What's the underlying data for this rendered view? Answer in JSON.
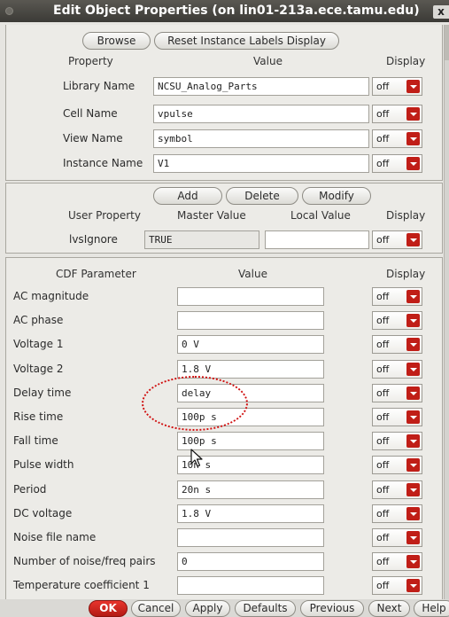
{
  "window": {
    "title": "Edit Object Properties (on lin01-213a.ece.tamu.edu)",
    "close_label": "x"
  },
  "toolbar": {
    "browse_label": "Browse",
    "reset_label": "Reset Instance Labels Display"
  },
  "instance": {
    "headers": {
      "property": "Property",
      "value": "Value",
      "display": "Display"
    },
    "rows": [
      {
        "label": "Library Name",
        "value": "NCSU_Analog_Parts",
        "display": "off"
      },
      {
        "label": "Cell Name",
        "value": "vpulse",
        "display": "off"
      },
      {
        "label": "View Name",
        "value": "symbol",
        "display": "off"
      },
      {
        "label": "Instance Name",
        "value": "V1",
        "display": "off"
      }
    ]
  },
  "user_props": {
    "add_label": "Add",
    "delete_label": "Delete",
    "modify_label": "Modify",
    "headers": {
      "property": "User Property",
      "master": "Master Value",
      "local": "Local Value",
      "display": "Display"
    },
    "rows": [
      {
        "label": "lvsIgnore",
        "master": "TRUE",
        "local": "",
        "display": "off"
      }
    ]
  },
  "cdf": {
    "headers": {
      "param": "CDF Parameter",
      "value": "Value",
      "display": "Display"
    },
    "rows": [
      {
        "label": "AC magnitude",
        "value": "",
        "display": "off"
      },
      {
        "label": "AC phase",
        "value": "",
        "display": "off"
      },
      {
        "label": "Voltage 1",
        "value": "0 V",
        "display": "off"
      },
      {
        "label": "Voltage 2",
        "value": "1.8 V",
        "display": "off"
      },
      {
        "label": "Delay time",
        "value": "delay",
        "display": "off"
      },
      {
        "label": "Rise time",
        "value": "100p s",
        "display": "off"
      },
      {
        "label": "Fall time",
        "value": "100p s",
        "display": "off"
      },
      {
        "label": "Pulse width",
        "value": "10n s",
        "display": "off"
      },
      {
        "label": "Period",
        "value": "20n s",
        "display": "off"
      },
      {
        "label": "DC voltage",
        "value": "1.8 V",
        "display": "off"
      },
      {
        "label": "Noise file name",
        "value": "",
        "display": "off"
      },
      {
        "label": "Number of noise/freq pairs",
        "value": "0",
        "display": "off"
      },
      {
        "label": "Temperature coefficient 1",
        "value": "",
        "display": "off"
      }
    ]
  },
  "actions": {
    "ok": "OK",
    "cancel": "Cancel",
    "apply": "Apply",
    "defaults": "Defaults",
    "previous": "Previous",
    "next": "Next",
    "help": "Help"
  },
  "colors": {
    "ok_button": "#c01e17",
    "dropdown_arrow": "#c01e17",
    "annotation": "#d01010"
  }
}
